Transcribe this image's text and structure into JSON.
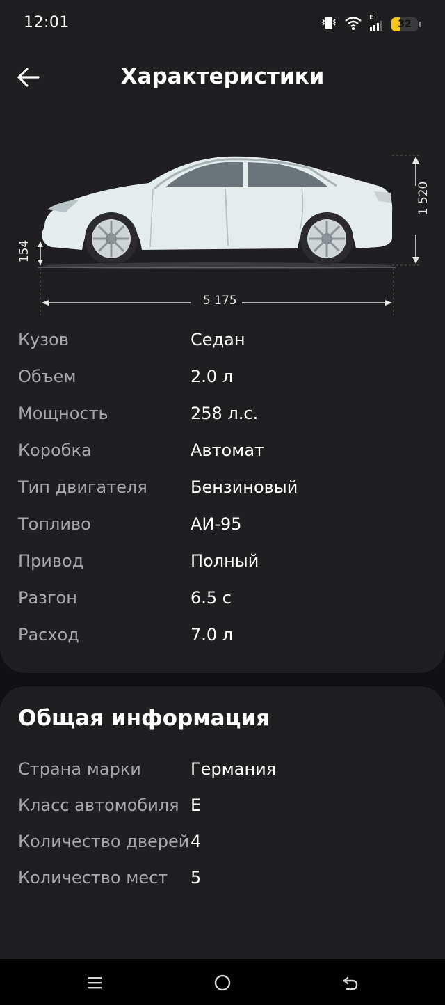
{
  "status_bar": {
    "time": "12:01",
    "battery_level": "32",
    "network_label": "E",
    "icons": [
      "vibrate-icon",
      "wifi-icon",
      "signal-icon",
      "battery-icon"
    ]
  },
  "header": {
    "title": "Характеристики",
    "back_icon": "arrow-left-icon"
  },
  "diagram": {
    "length": "5 175",
    "height": "1 520",
    "clearance": "154",
    "body_color": "#dfe9e8"
  },
  "specs": [
    {
      "label": "Кузов",
      "value": "Седан"
    },
    {
      "label": "Объем",
      "value": "2.0 л"
    },
    {
      "label": "Мощность",
      "value": "258 л.с."
    },
    {
      "label": "Коробка",
      "value": "Автомат"
    },
    {
      "label": "Тип двигателя",
      "value": "Бензиновый"
    },
    {
      "label": "Топливо",
      "value": "АИ-95"
    },
    {
      "label": "Привод",
      "value": "Полный"
    },
    {
      "label": "Разгон",
      "value": "6.5 с"
    },
    {
      "label": "Расход",
      "value": "7.0 л"
    }
  ],
  "general": {
    "title": "Общая информация",
    "items": [
      {
        "label": "Страна марки",
        "value": "Германия"
      },
      {
        "label": "Класс автомобиля",
        "value": "E"
      },
      {
        "label": "Количество дверей",
        "value": "4"
      },
      {
        "label": "Количество мест",
        "value": "5"
      }
    ]
  },
  "nav_bar": {
    "icons": [
      "menu-icon",
      "home-icon",
      "back-icon"
    ]
  },
  "colors": {
    "background": "#111113",
    "card": "#1f1e21",
    "label": "#a8a7ab",
    "text": "#ffffff",
    "battery": "#f5c518"
  }
}
